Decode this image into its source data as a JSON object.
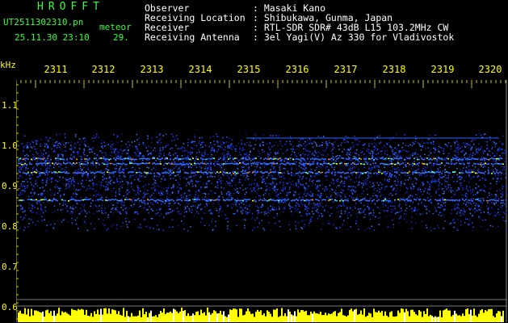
{
  "header": {
    "logo": "HROFFT",
    "filename": "UT2511302310.pn",
    "tag": "meteor",
    "datetime": "25.11.30 23:10",
    "count": "29.",
    "info": [
      {
        "label": "Observer",
        "value": ": Masaki Kano"
      },
      {
        "label": "Receiving Location",
        "value": ": Shibukawa, Gunma, Japan"
      },
      {
        "label": "Receiver",
        "value": ": RTL-SDR SDR# 43dB L15 103.2MHz CW"
      },
      {
        "label": "Receiving Antenna",
        "value": ": 3el Yagi(V) Az 330 for Vladivostok"
      }
    ]
  },
  "axis": {
    "unit": "kHz",
    "x_ticks": [
      "2311",
      "2312",
      "2313",
      "2314",
      "2315",
      "2316",
      "2317",
      "2318",
      "2319",
      "2320"
    ],
    "y_ticks": [
      "1.1",
      "1.0",
      "0.9",
      "0.8",
      "0.7",
      "0.6"
    ]
  },
  "colors": {
    "header_text": "#33ff33",
    "label_text": "#ffffff",
    "tick_text": "#ffff00",
    "gridline": "#c8c800",
    "signal_low": "#1a2cff",
    "signal_high": "#ffff00"
  }
}
